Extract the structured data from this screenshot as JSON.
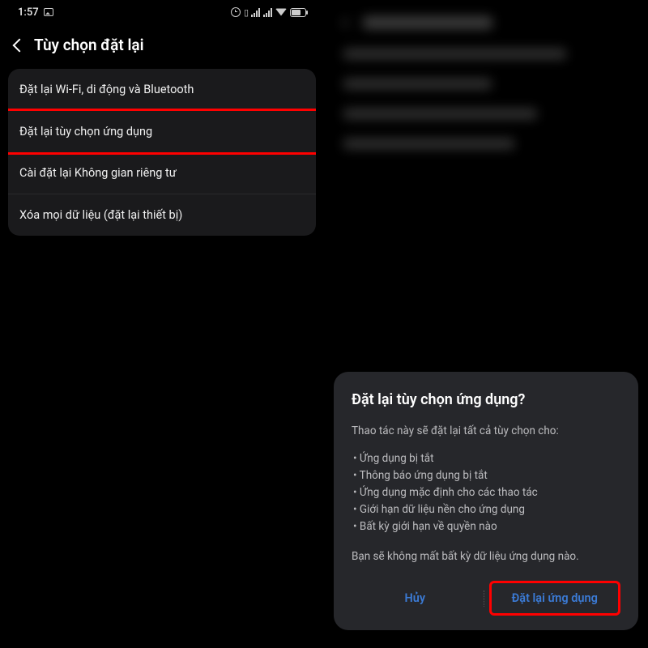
{
  "status": {
    "time": "1:57"
  },
  "header": {
    "title": "Tùy chọn đặt lại"
  },
  "settings": {
    "items": [
      {
        "label": "Đặt lại Wi-Fi, di động và Bluetooth"
      },
      {
        "label": "Đặt lại tùy chọn ứng dụng"
      },
      {
        "label": "Cài đặt lại Không gian riêng tư"
      },
      {
        "label": "Xóa mọi dữ liệu (đặt lại thiết bị)"
      }
    ]
  },
  "dialog": {
    "title": "Đặt lại tùy chọn ứng dụng?",
    "lead": "Thao tác này sẽ đặt lại tất cả tùy chọn cho:",
    "bullets": [
      "Ứng dụng bị tắt",
      "Thông báo ứng dụng bị tắt",
      "Ứng dụng mặc định cho các thao tác",
      "Giới hạn dữ liệu nền cho ứng dụng",
      "Bất kỳ giới hạn về quyền nào"
    ],
    "note": "Bạn sẽ không mất bất kỳ dữ liệu ứng dụng nào.",
    "cancel": "Hủy",
    "confirm": "Đặt lại ứng dụng"
  },
  "colors": {
    "highlight": "#ff0000",
    "accent": "#3b7bd6"
  }
}
